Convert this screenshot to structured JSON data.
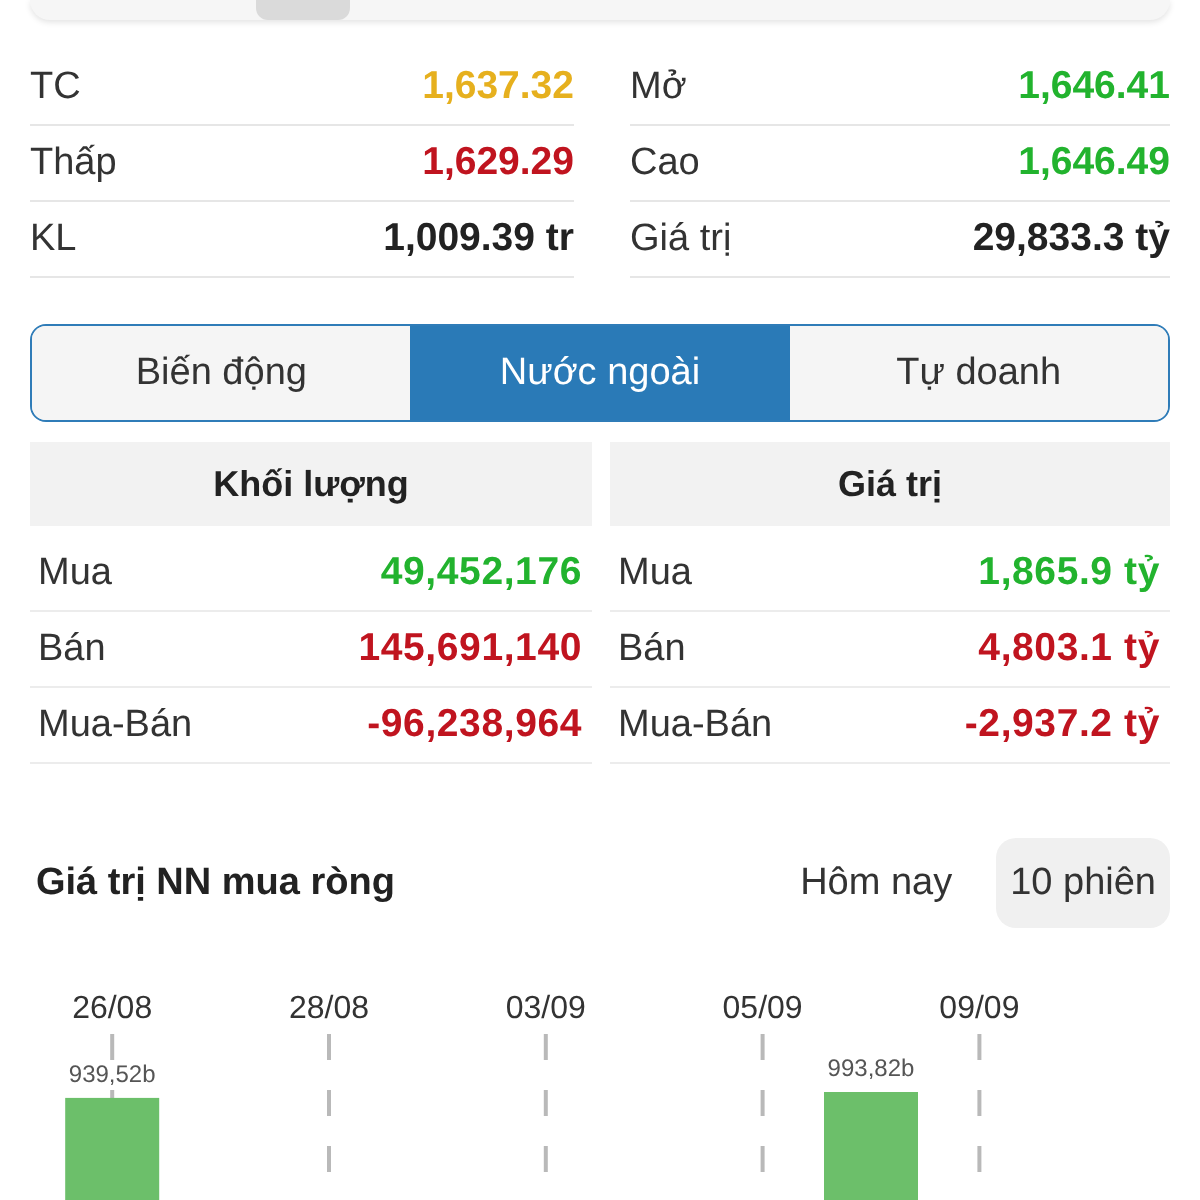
{
  "stats": [
    {
      "label": "TC",
      "value": "1,637.32",
      "color": "#e6b01e"
    },
    {
      "label": "Mở",
      "value": "1,646.41",
      "color": "#22b32e"
    },
    {
      "label": "Thấp",
      "value": "1,629.29",
      "color": "#c0141f"
    },
    {
      "label": "Cao",
      "value": "1,646.49",
      "color": "#22b32e"
    },
    {
      "label": "KL",
      "value": "1,009.39 tr",
      "color": "#222222"
    },
    {
      "label": "Giá trị",
      "value": "29,833.3 tỷ",
      "color": "#222222"
    }
  ],
  "tabs": [
    {
      "label": "Biến động",
      "selected": false
    },
    {
      "label": "Nước ngoài",
      "selected": true
    },
    {
      "label": "Tự doanh",
      "selected": false
    }
  ],
  "foreign": {
    "columns": [
      {
        "title": "Khối lượng",
        "rows": [
          {
            "label": "Mua",
            "value": "49,452,176",
            "color": "#22b32e"
          },
          {
            "label": "Bán",
            "value": "145,691,140",
            "color": "#c0141f"
          },
          {
            "label": "Mua-Bán",
            "value": "-96,238,964",
            "color": "#c0141f"
          }
        ]
      },
      {
        "title": "Giá trị",
        "rows": [
          {
            "label": "Mua",
            "value": "1,865.9 tỷ",
            "color": "#22b32e"
          },
          {
            "label": "Bán",
            "value": "4,803.1 tỷ",
            "color": "#c0141f"
          },
          {
            "label": "Mua-Bán",
            "value": "-2,937.2 tỷ",
            "color": "#c0141f"
          }
        ]
      }
    ]
  },
  "net_buy": {
    "title": "Giá trị NN mua ròng",
    "periods": [
      {
        "label": "Hôm nay",
        "selected": false
      },
      {
        "label": "10 phiên",
        "selected": true
      }
    ],
    "chart_data": {
      "type": "bar",
      "categories": [
        "26/08",
        null,
        "28/08",
        null,
        "03/09",
        null,
        "05/09",
        null,
        "09/09",
        null
      ],
      "values": [
        939.52,
        null,
        null,
        null,
        null,
        null,
        null,
        993.82,
        null,
        null
      ],
      "value_labels": [
        "939,52b",
        null,
        null,
        null,
        null,
        null,
        null,
        "993,82b",
        null,
        null
      ],
      "grid": true
    }
  }
}
